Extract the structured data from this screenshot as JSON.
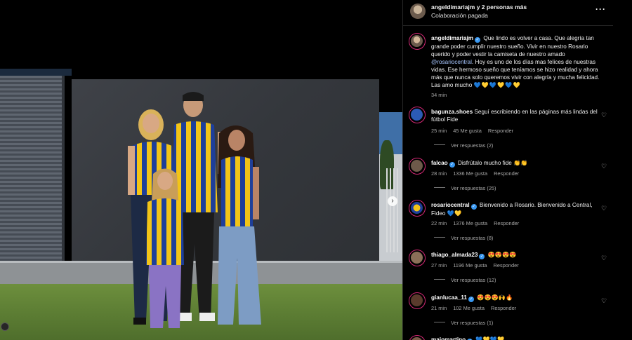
{
  "header": {
    "username": "angeldimariajm y 2 personas más",
    "subtitle": "Colaboración pagada",
    "more_icon": "more-horizontal-icon"
  },
  "caption": {
    "username": "angeldimariajm",
    "text_1": "Que lindo es volver a casa. Que alegría tan grande poder cumplir nuestro sueño. Vivir en nuestro Rosario querido y poder vestir la camiseta de nuestro amado",
    "mention": "@rosariocentral",
    "text_2": ". Hoy es uno de los días mas felices de nuestras vidas. Ese hermoso sueño que teníamos se hizo realidad y ahora más que nunca solo queremos vivir con alegría y mucha felicidad. Las amo mucho",
    "emojis": "💙💛💙💛💙💛",
    "time": "34 min"
  },
  "comments": [
    {
      "username": "bagunza.shoes",
      "verified": false,
      "text": "Seguí escribiendo en las páginas más lindas del fútbol Fide",
      "time": "25 min",
      "likes": "45 Me gusta",
      "reply": "Responder",
      "replies": "Ver respuestas (2)"
    },
    {
      "username": "falcao",
      "verified": true,
      "text": "Disfrútalo mucho fide 👏👏",
      "time": "28 min",
      "likes": "1336 Me gusta",
      "reply": "Responder",
      "replies": "Ver respuestas (25)"
    },
    {
      "username": "rosariocentral",
      "verified": true,
      "text": "Bienvenido a Rosario. Bienvenido a Central, Fideo 💙💛",
      "time": "22 min",
      "likes": "1376 Me gusta",
      "reply": "Responder",
      "replies": "Ver respuestas (8)"
    },
    {
      "username": "thiago_almada23",
      "verified": true,
      "text": "😍😍😍😍",
      "time": "27 min",
      "likes": "1196 Me gusta",
      "reply": "Responder",
      "replies": "Ver respuestas (12)"
    },
    {
      "username": "gianlucaa_11",
      "verified": true,
      "text": "😍😍😍🙌🔥",
      "time": "21 min",
      "likes": "102 Me gusta",
      "reply": "Responder",
      "replies": "Ver respuestas (1)"
    }
  ],
  "partial_comment": {
    "username": "majomartino",
    "text": "💙💛💙💛"
  },
  "colors": {
    "background": "#000000",
    "verified": "#3897f0",
    "muted": "#a8a8a8",
    "mention": "#a8c7ff"
  }
}
